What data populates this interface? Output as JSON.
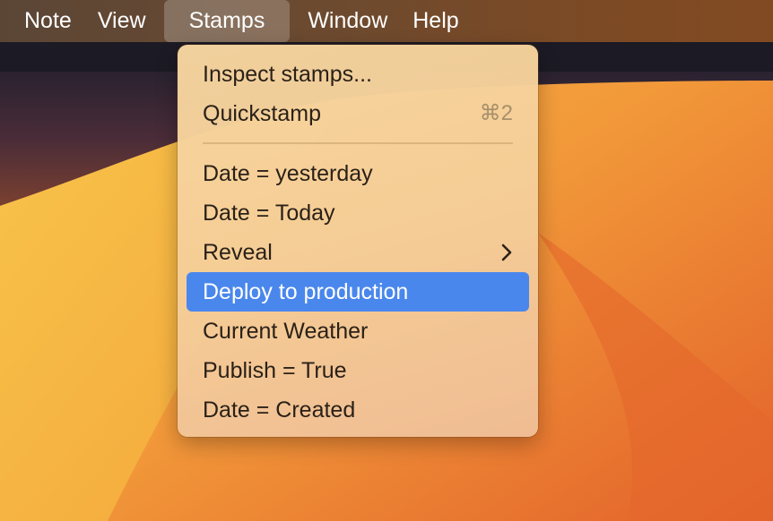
{
  "menubar": {
    "items": [
      {
        "label": "Note"
      },
      {
        "label": "View"
      },
      {
        "label": "Stamps"
      },
      {
        "label": "Window"
      },
      {
        "label": "Help"
      }
    ]
  },
  "stamps_menu": {
    "inspect_label": "Inspect stamps...",
    "quickstamp_label": "Quickstamp",
    "quickstamp_shortcut": "⌘2",
    "items": [
      {
        "label": "Date = yesterday"
      },
      {
        "label": "Date = Today"
      },
      {
        "label": "Reveal",
        "submenu_icon": "chevron-right-icon"
      },
      {
        "label": "Deploy to production",
        "highlighted": true
      },
      {
        "label": "Current Weather"
      },
      {
        "label": "Publish = True"
      },
      {
        "label": "Date = Created"
      }
    ]
  },
  "colors": {
    "highlight": "#4a87ec",
    "wallpaper_orange": "#f0a040"
  }
}
